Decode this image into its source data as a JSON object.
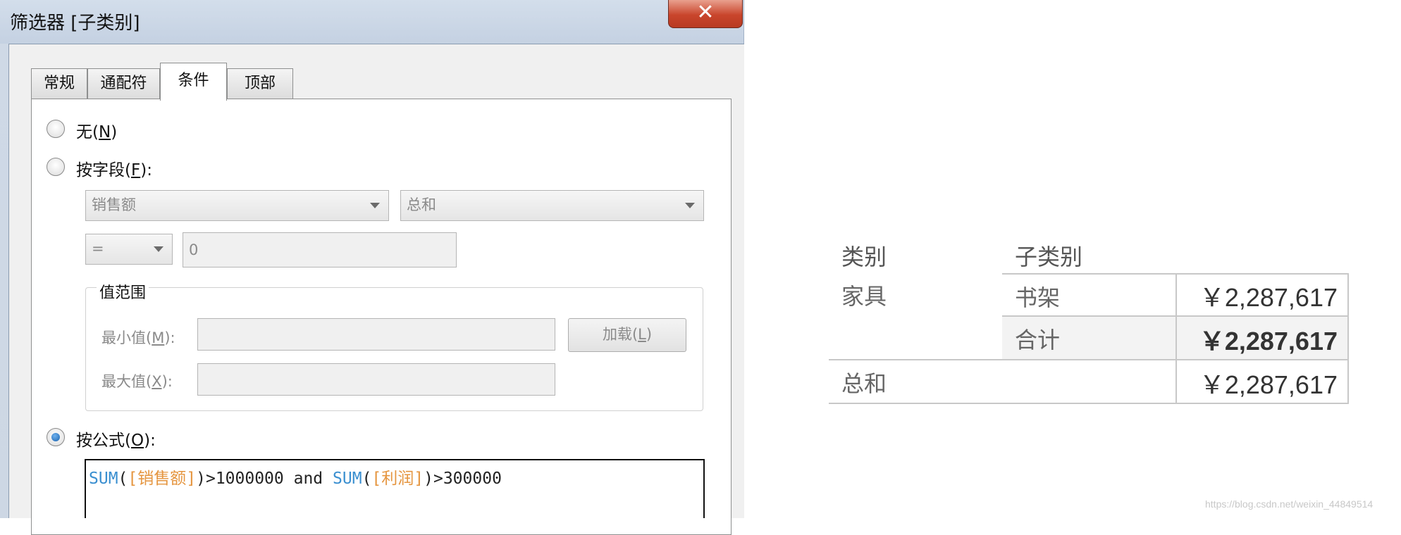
{
  "dialog": {
    "title": "筛选器 [子类别]",
    "close_glyph": "✕",
    "tabs": [
      "常规",
      "通配符",
      "条件",
      "顶部"
    ],
    "active_tab": "条件",
    "options": {
      "none": {
        "label": "无",
        "mnemonic": "N"
      },
      "by_field": {
        "label": "按字段",
        "mnemonic": "F"
      },
      "by_formula": {
        "label": "按公式",
        "mnemonic": "O"
      }
    },
    "selected_option": "by_formula",
    "field_combo": "销售额",
    "aggregation_combo": "总和",
    "operator_combo": "=",
    "value_input": "0",
    "range_group": {
      "legend": "值范围",
      "min_label": "最小值",
      "min_mnemonic": "M",
      "max_label": "最大值",
      "max_mnemonic": "X",
      "load_button": "加载",
      "load_mnemonic": "L",
      "min_value": "",
      "max_value": ""
    },
    "formula": {
      "fn1": "SUM",
      "field1": "[销售额]",
      "cmp1": ">1000000",
      "and": "and",
      "fn2": "SUM",
      "field2": "[利润]",
      "cmp2": ">300000"
    }
  },
  "crosstab": {
    "headers": [
      "类别",
      "子类别"
    ],
    "rows": [
      {
        "category": "家具",
        "subcategory": "书架",
        "value": "￥2,287,617"
      },
      {
        "category": "",
        "subcategory": "合计",
        "value": "￥2,287,617"
      },
      {
        "category": "总和",
        "subcategory": "",
        "value": "￥2,287,617"
      }
    ]
  },
  "watermark": "https://blog.csdn.net/weixin_44849514"
}
